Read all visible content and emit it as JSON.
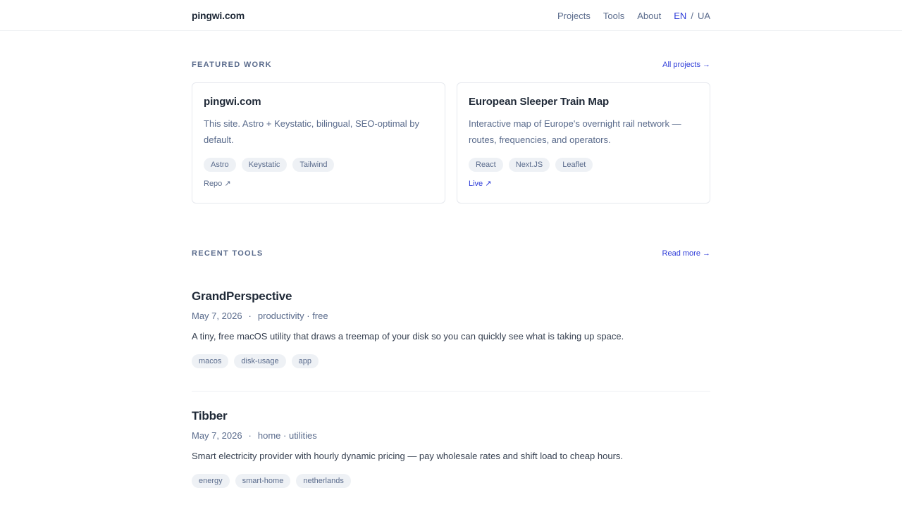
{
  "header": {
    "logo": "pingwi.com",
    "nav": [
      "Projects",
      "Tools",
      "About"
    ],
    "lang": {
      "active": "EN",
      "separator": "/",
      "other": "UA"
    }
  },
  "featured": {
    "title": "FEATURED WORK",
    "link": "All projects →",
    "cards": [
      {
        "title": "pingwi.com",
        "description": "This site. Astro + Keystatic, bilingual, SEO-optimal by default.",
        "tags": [
          "Astro",
          "Keystatic",
          "Tailwind"
        ],
        "link": "Repo ↗"
      },
      {
        "title": "European Sleeper Train Map",
        "description": "Interactive map of Europe's overnight rail network — routes, frequencies, and operators.",
        "tags": [
          "React",
          "Next.JS",
          "Leaflet"
        ],
        "link": "Live ↗"
      }
    ]
  },
  "recent": {
    "title": "RECENT TOOLS",
    "link": "Read more →",
    "items": [
      {
        "title": "GrandPerspective",
        "date": "May 7, 2026",
        "meta_sep": "·",
        "category": "productivity · free",
        "description": "A tiny, free macOS utility that draws a treemap of your disk so you can quickly see what is taking up space.",
        "tags": [
          "macos",
          "disk-usage",
          "app"
        ]
      },
      {
        "title": "Tibber",
        "date": "May 7, 2026",
        "meta_sep": "·",
        "category": "home · utilities",
        "description": "Smart electricity provider with hourly dynamic pricing — pay wholesale rates and shift load to cheap hours.",
        "tags": [
          "energy",
          "smart-home",
          "netherlands"
        ]
      }
    ]
  },
  "colors": {
    "accent": "#2d3bd8",
    "muted": "#5a6b8c",
    "text": "#1f2937",
    "tag_bg": "#eef1f5"
  }
}
